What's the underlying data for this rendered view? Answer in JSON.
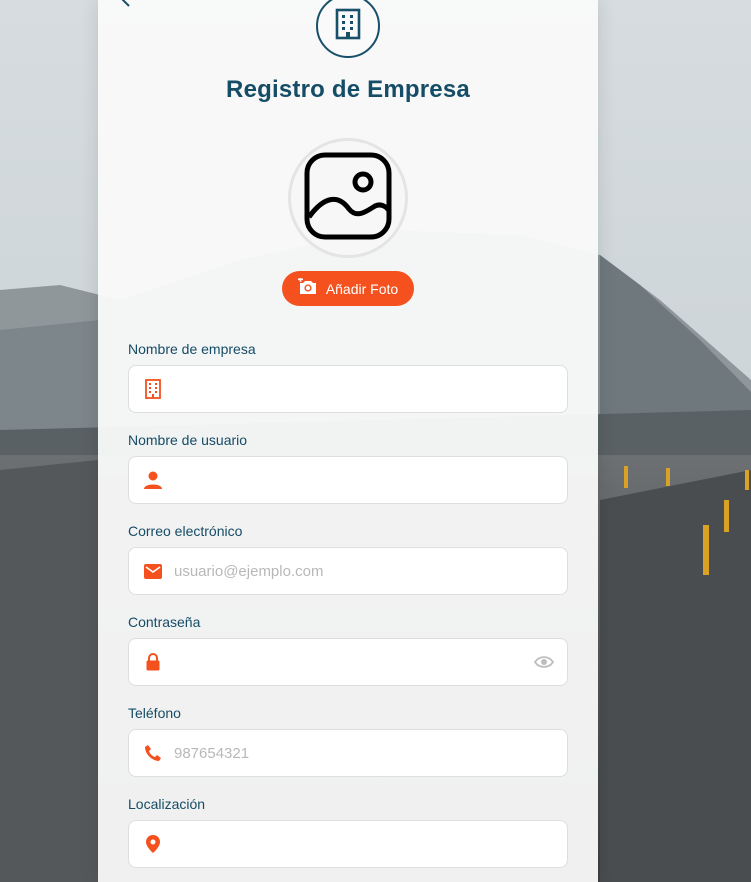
{
  "page": {
    "title": "Registro de Empresa",
    "add_photo_label": "Añadir Foto"
  },
  "colors": {
    "accent": "#f4511e",
    "primary": "#154c66"
  },
  "fields": [
    {
      "label": "Nombre de empresa",
      "icon": "building-icon",
      "value": "",
      "placeholder": ""
    },
    {
      "label": "Nombre de usuario",
      "icon": "user-icon",
      "value": "",
      "placeholder": ""
    },
    {
      "label": "Correo electrónico",
      "icon": "mail-icon",
      "value": "",
      "placeholder": "usuario@ejemplo.com"
    },
    {
      "label": "Contraseña",
      "icon": "lock-icon",
      "value": "",
      "placeholder": ""
    },
    {
      "label": "Teléfono",
      "icon": "phone-icon",
      "value": "",
      "placeholder": "987654321"
    },
    {
      "label": "Localización",
      "icon": "location-pin-icon",
      "value": "",
      "placeholder": ""
    }
  ]
}
